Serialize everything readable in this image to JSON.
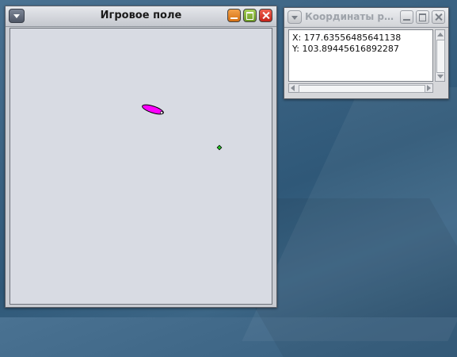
{
  "game_window": {
    "title": "Игровое поле",
    "colors": {
      "boat": "#ff00ff",
      "target": "#22cc22",
      "field_bg": "#d8dbe3"
    }
  },
  "coords_window": {
    "title": "Координаты р…",
    "x_line": "X: 177.63556485641138",
    "y_line": "Y: 103.89445616892287"
  }
}
